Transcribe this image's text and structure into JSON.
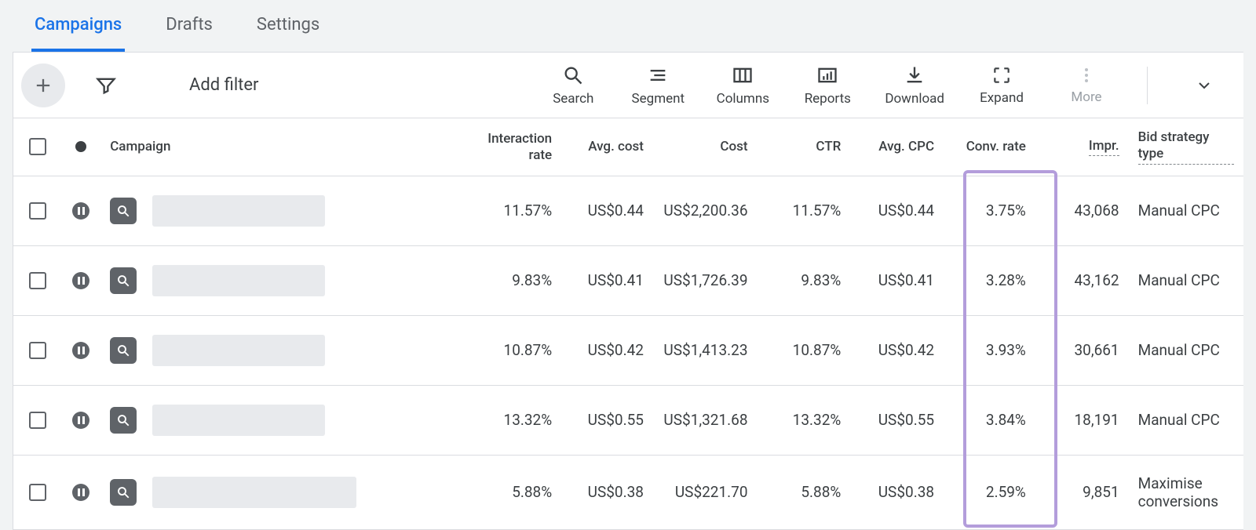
{
  "tabs": [
    {
      "label": "Campaigns",
      "active": true
    },
    {
      "label": "Drafts",
      "active": false
    },
    {
      "label": "Settings",
      "active": false
    }
  ],
  "toolbar": {
    "add_filter": "Add filter",
    "actions": {
      "search": "Search",
      "segment": "Segment",
      "columns": "Columns",
      "reports": "Reports",
      "download": "Download",
      "expand": "Expand",
      "more": "More"
    }
  },
  "table": {
    "headers": {
      "campaign": "Campaign",
      "interaction_rate": "Interaction rate",
      "avg_cost": "Avg. cost",
      "cost": "Cost",
      "ctr": "CTR",
      "avg_cpc": "Avg. CPC",
      "conv_rate": "Conv. rate",
      "impr": "Impr.",
      "bid_strategy": "Bid strategy type"
    },
    "rows": [
      {
        "interaction_rate": "11.57%",
        "avg_cost": "US$0.44",
        "cost": "US$2,200.36",
        "ctr": "11.57%",
        "avg_cpc": "US$0.44",
        "conv_rate": "3.75%",
        "impr": "43,068",
        "bid_strategy": "Manual CPC"
      },
      {
        "interaction_rate": "9.83%",
        "avg_cost": "US$0.41",
        "cost": "US$1,726.39",
        "ctr": "9.83%",
        "avg_cpc": "US$0.41",
        "conv_rate": "3.28%",
        "impr": "43,162",
        "bid_strategy": "Manual CPC"
      },
      {
        "interaction_rate": "10.87%",
        "avg_cost": "US$0.42",
        "cost": "US$1,413.23",
        "ctr": "10.87%",
        "avg_cpc": "US$0.42",
        "conv_rate": "3.93%",
        "impr": "30,661",
        "bid_strategy": "Manual CPC"
      },
      {
        "interaction_rate": "13.32%",
        "avg_cost": "US$0.55",
        "cost": "US$1,321.68",
        "ctr": "13.32%",
        "avg_cpc": "US$0.55",
        "conv_rate": "3.84%",
        "impr": "18,191",
        "bid_strategy": "Manual CPC"
      },
      {
        "interaction_rate": "5.88%",
        "avg_cost": "US$0.38",
        "cost": "US$221.70",
        "ctr": "5.88%",
        "avg_cpc": "US$0.38",
        "conv_rate": "2.59%",
        "impr": "9,851",
        "bid_strategy": "Maximise conversions",
        "bid_link": true
      }
    ]
  },
  "highlight_column": "conv_rate"
}
